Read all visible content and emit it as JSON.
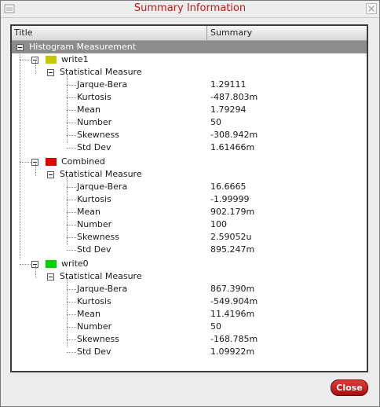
{
  "window": {
    "title": "Summary Information"
  },
  "table": {
    "col_title": "Title",
    "col_summary": "Summary"
  },
  "root": {
    "label": "Histogram Measurement"
  },
  "groups": [
    {
      "name": "write1",
      "color": "#c8c800",
      "section": "Statistical Measure",
      "rows": [
        {
          "label": "Jarque-Bera",
          "value": "1.29111"
        },
        {
          "label": "Kurtosis",
          "value": "-487.803m"
        },
        {
          "label": "Mean",
          "value": "1.79294"
        },
        {
          "label": "Number",
          "value": "50"
        },
        {
          "label": "Skewness",
          "value": "-308.942m"
        },
        {
          "label": "Std Dev",
          "value": "1.61466m"
        }
      ]
    },
    {
      "name": "Combined",
      "color": "#e00000",
      "section": "Statistical Measure",
      "rows": [
        {
          "label": "Jarque-Bera",
          "value": "16.6665"
        },
        {
          "label": "Kurtosis",
          "value": "-1.99999"
        },
        {
          "label": "Mean",
          "value": "902.179m"
        },
        {
          "label": "Number",
          "value": "100"
        },
        {
          "label": "Skewness",
          "value": "2.59052u"
        },
        {
          "label": "Std Dev",
          "value": "895.247m"
        }
      ]
    },
    {
      "name": "write0",
      "color": "#00d000",
      "section": "Statistical Measure",
      "rows": [
        {
          "label": "Jarque-Bera",
          "value": "867.390m"
        },
        {
          "label": "Kurtosis",
          "value": "-549.904m"
        },
        {
          "label": "Mean",
          "value": "11.4196m"
        },
        {
          "label": "Number",
          "value": "50"
        },
        {
          "label": "Skewness",
          "value": "-168.785m"
        },
        {
          "label": "Std Dev",
          "value": "1.09922m"
        }
      ]
    }
  ],
  "buttons": {
    "close": "Close"
  }
}
